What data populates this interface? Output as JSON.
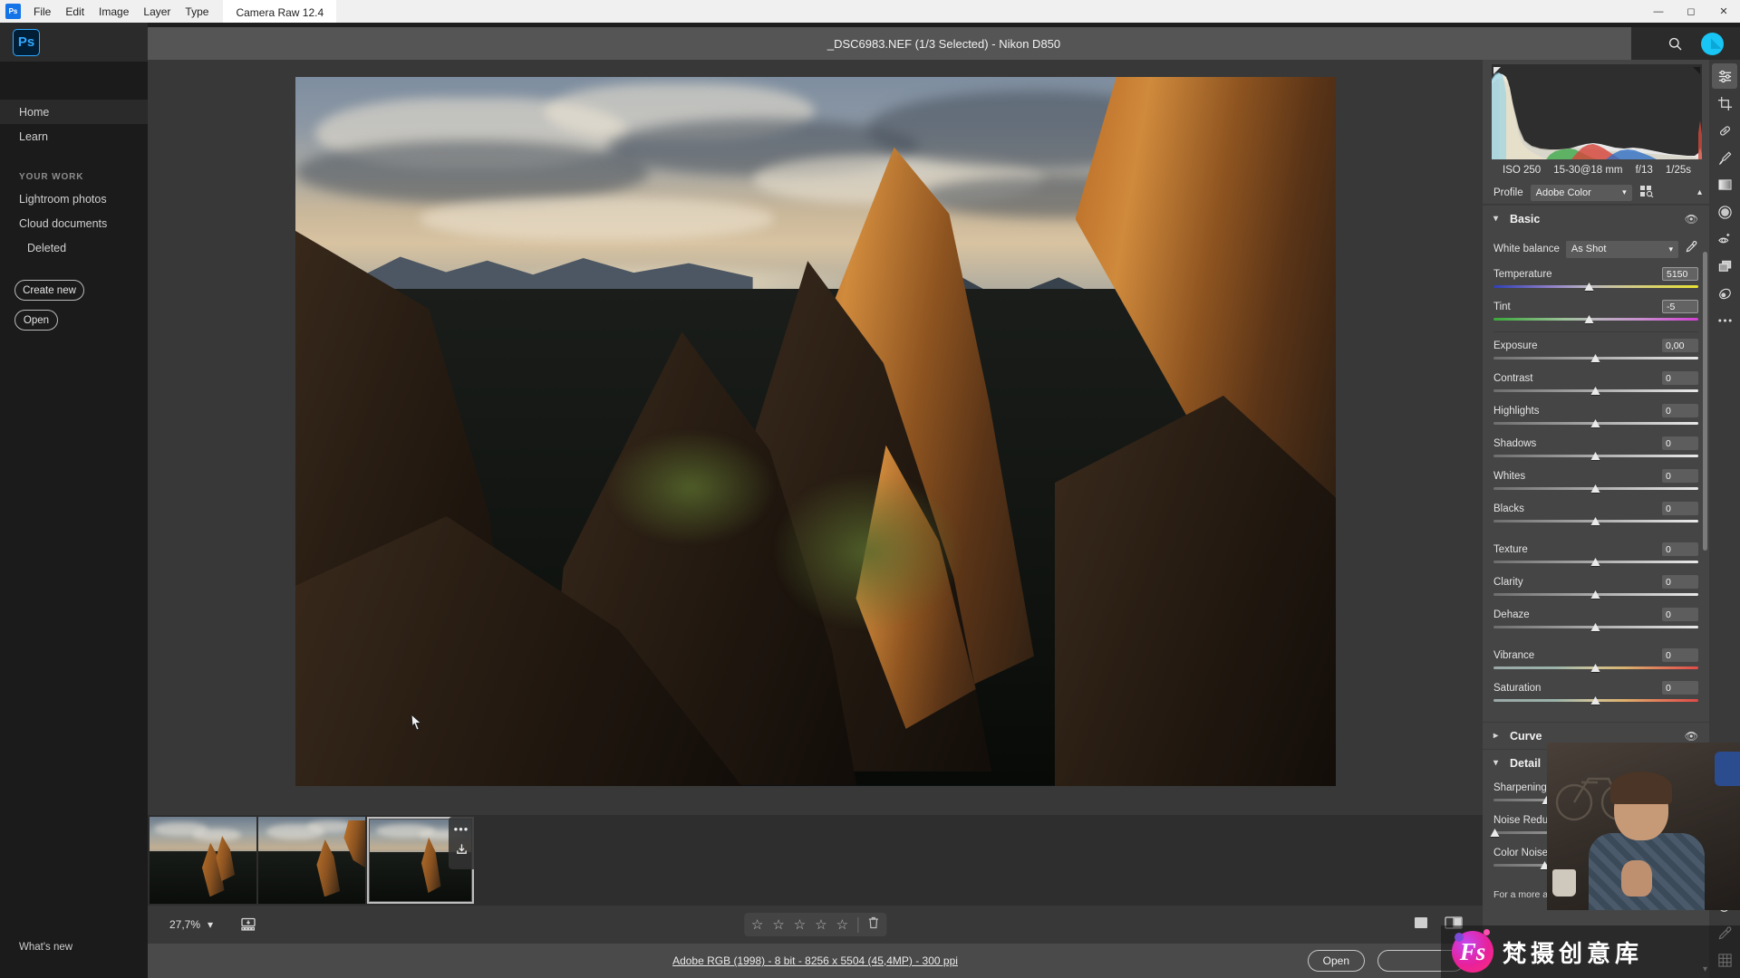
{
  "window": {
    "app_tab": "Camera Raw 12.4",
    "menu": [
      "File",
      "Edit",
      "Image",
      "Layer",
      "Type"
    ],
    "app_badge": "Ps",
    "controls": [
      "minimize",
      "maximize",
      "close"
    ]
  },
  "home_sidebar": {
    "logo": "Ps",
    "items": [
      {
        "label": "Home",
        "name": "sidebar-item-home",
        "active": true
      },
      {
        "label": "Learn",
        "name": "sidebar-item-learn",
        "active": false
      }
    ],
    "section_title": "YOUR WORK",
    "work_items": [
      {
        "label": "Lightroom photos",
        "name": "sidebar-item-lightroom-photos"
      },
      {
        "label": "Cloud documents",
        "name": "sidebar-item-cloud-documents"
      },
      {
        "label": "Deleted",
        "name": "sidebar-item-deleted"
      }
    ],
    "create_new": "Create new",
    "open": "Open",
    "whats_new": "What's new"
  },
  "acr": {
    "title_file": "_DSC6983.NEF (1/3 Selected)",
    "title_sep": "-",
    "title_camera": "Nikon D850",
    "header_icons": [
      "save-icon",
      "gear-icon",
      "expand-icon",
      "search-icon",
      "avatar"
    ]
  },
  "histogram": {
    "iso": "ISO 250",
    "lens": "15-30@18 mm",
    "aperture": "f/13",
    "shutter": "1/25s",
    "profile_label": "Profile",
    "profile_value": "Adobe Color"
  },
  "basic_panel": {
    "title": "Basic",
    "white_balance_label": "White balance",
    "white_balance_value": "As Shot",
    "sliders": [
      {
        "name": "Temperature",
        "value": "5150",
        "pos": 47,
        "track": "temp",
        "focus": true
      },
      {
        "name": "Tint",
        "value": "-5",
        "pos": 47,
        "track": "tint",
        "focus": true
      },
      {
        "name": "Exposure",
        "value": "0,00",
        "pos": 50,
        "track": "plain"
      },
      {
        "name": "Contrast",
        "value": "0",
        "pos": 50,
        "track": "plain"
      },
      {
        "name": "Highlights",
        "value": "0",
        "pos": 50,
        "track": "plain"
      },
      {
        "name": "Shadows",
        "value": "0",
        "pos": 50,
        "track": "plain"
      },
      {
        "name": "Whites",
        "value": "0",
        "pos": 50,
        "track": "plain"
      },
      {
        "name": "Blacks",
        "value": "0",
        "pos": 50,
        "track": "plain"
      },
      {
        "name": "Texture",
        "value": "0",
        "pos": 50,
        "track": "plain"
      },
      {
        "name": "Clarity",
        "value": "0",
        "pos": 50,
        "track": "plain"
      },
      {
        "name": "Dehaze",
        "value": "0",
        "pos": 50,
        "track": "plain"
      },
      {
        "name": "Vibrance",
        "value": "0",
        "pos": 50,
        "track": "vib"
      },
      {
        "name": "Saturation",
        "value": "0",
        "pos": 50,
        "track": "sat"
      }
    ]
  },
  "curve_panel": {
    "title": "Curve"
  },
  "detail_panel": {
    "title": "Detail",
    "sliders": [
      {
        "name": "Sharpening",
        "value": "40",
        "pos": 26
      },
      {
        "name": "Noise Reduction",
        "value": "0",
        "pos": 0
      },
      {
        "name": "Color Noise Reduction",
        "value": "25",
        "pos": 25
      }
    ],
    "note": "For a more accurate preview, zoom the preview"
  },
  "toolrail": {
    "tools": [
      {
        "name": "edit-sliders-icon",
        "active": true
      },
      {
        "name": "crop-icon",
        "active": false
      },
      {
        "name": "healing-brush-icon",
        "active": false
      },
      {
        "name": "adjustment-brush-icon",
        "active": false
      },
      {
        "name": "graduated-filter-icon",
        "active": false
      },
      {
        "name": "radial-filter-icon",
        "active": false
      },
      {
        "name": "red-eye-icon",
        "active": false
      },
      {
        "name": "presets-icon",
        "active": false
      },
      {
        "name": "snapshots-icon",
        "active": false
      },
      {
        "name": "more-options-icon",
        "active": false
      }
    ]
  },
  "filmstrip": {
    "thumbnails": [
      {
        "name": "filmstrip-thumbnail-1",
        "selected": false
      },
      {
        "name": "filmstrip-thumbnail-2",
        "selected": false
      },
      {
        "name": "filmstrip-thumbnail-3",
        "selected": true
      }
    ],
    "overlay_dots": "•••"
  },
  "bottom_bar": {
    "zoom_level": "27,7%",
    "stars": [
      "☆",
      "☆",
      "☆",
      "☆",
      "☆"
    ],
    "rating_value": 0
  },
  "status_bar": {
    "text": "Adobe RGB (1998) - 8 bit - 8256 x 5504 (45,4MP) - 300 ppi",
    "open_button": "Open",
    "second_button": ""
  },
  "watermark": {
    "letters": "Fs",
    "text": "梵摄创意库"
  },
  "colors": {
    "accent_blue": "#31a8ff",
    "panel_bg": "#454545",
    "canvas_bg": "#383838",
    "header_bg": "#555555",
    "sidebar_bg": "#1b1b1b",
    "avatar_cyan": "#18c5f4"
  }
}
